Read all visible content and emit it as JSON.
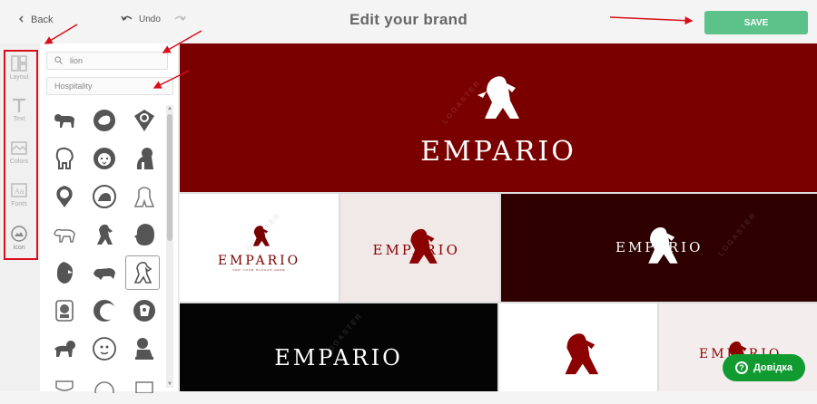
{
  "header": {
    "back_label": "Back",
    "undo_label": "Undo",
    "title": "Edit your brand",
    "save_label": "SAVE"
  },
  "rail": {
    "items": [
      {
        "label": "Layout",
        "icon": "layout-icon"
      },
      {
        "label": "Text",
        "icon": "text-icon"
      },
      {
        "label": "Colors",
        "icon": "colors-icon"
      },
      {
        "label": "Fonts",
        "icon": "fonts-icon"
      },
      {
        "label": "Icon",
        "icon": "icon-icon"
      }
    ]
  },
  "panel": {
    "search_value": "lion",
    "category_value": "Hospitality"
  },
  "canvas": {
    "brand_name": "EMPARIO",
    "slogan": "ADD YOUR SLOGAN HERE",
    "watermark": "LOGASTER",
    "colors": {
      "primary": "#7a0000",
      "dark_red": "#2e0000",
      "light_pink": "#f1e8e8",
      "black": "#040404",
      "white": "#ffffff"
    }
  },
  "help_label": "Довідка",
  "annotation_color": "#d80f1a"
}
